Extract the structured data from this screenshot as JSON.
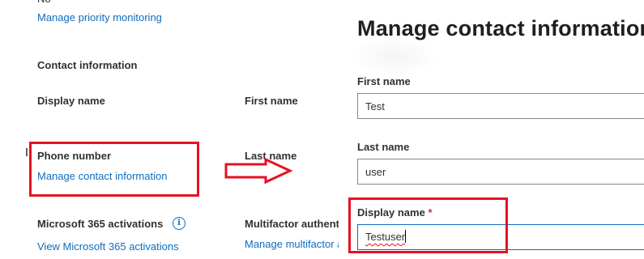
{
  "left": {
    "top_value": "No",
    "priority_link": "Manage priority monitoring",
    "contact_heading": "Contact information",
    "display_name_label": "Display name",
    "first_name_label": "First name",
    "phone_label": "Phone number",
    "manage_contact_link": "Manage contact information",
    "last_name_label": "Last name",
    "activations_label": "Microsoft 365 activations",
    "activations_link": "View Microsoft 365 activations",
    "mfa_label": "Multifactor authentication",
    "mfa_link": "Manage multifactor authentication"
  },
  "panel": {
    "title": "Manage contact information",
    "first_name": {
      "label": "First name",
      "value": "Test"
    },
    "last_name": {
      "label": "Last name",
      "value": "user"
    },
    "display_name": {
      "label": "Display name",
      "required_mark": "*",
      "value": "Testuser"
    }
  },
  "annotations": {
    "box_color": "#e81123",
    "arrow_color": "#e81123"
  }
}
